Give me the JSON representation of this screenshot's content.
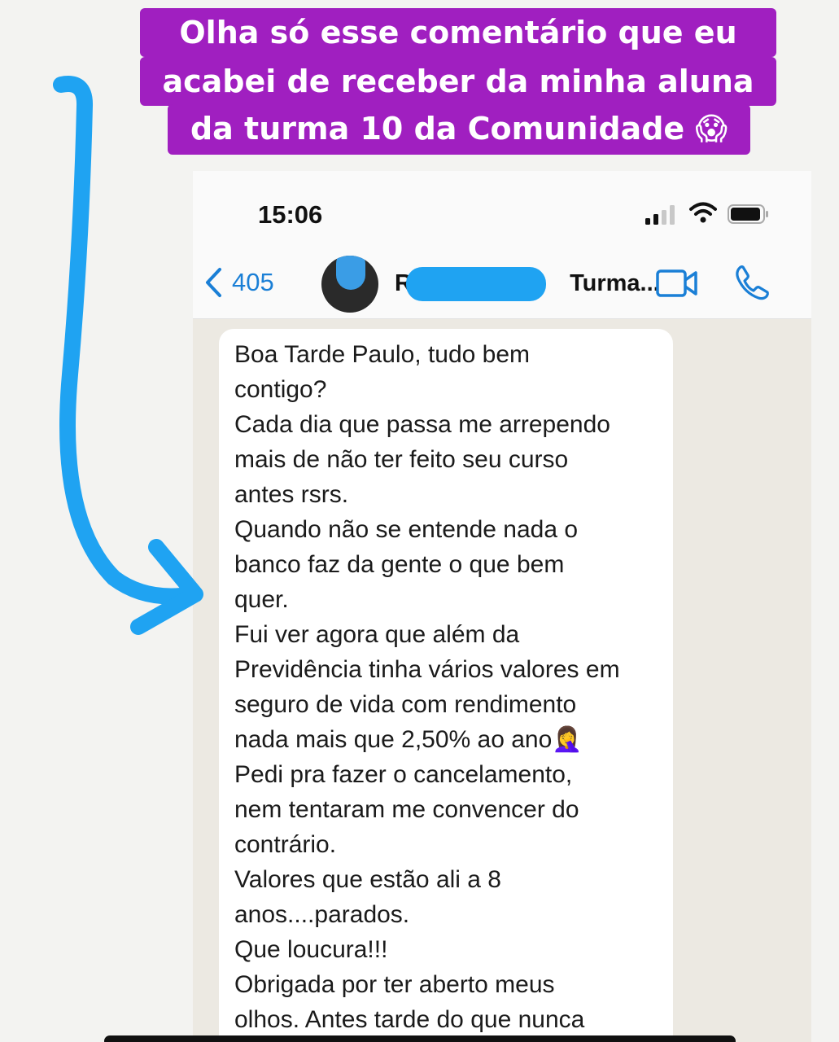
{
  "caption": {
    "line1": "Olha só esse comentário que eu",
    "line2": "acabei de receber da minha aluna",
    "line3": "da turma 10 da Comunidade 😱"
  },
  "status_bar": {
    "time": "15:06"
  },
  "chat_header": {
    "back_count": "405",
    "contact_name_start": "R",
    "contact_name_end": "Turma..."
  },
  "message": {
    "lines": [
      "Boa Tarde Paulo, tudo bem",
      "contigo?",
      "Cada dia que passa me arrependo",
      "mais de não ter feito seu curso",
      "antes rsrs.",
      "Quando não se entende nada o",
      "banco faz da gente o que bem",
      "quer.",
      "Fui ver agora que além da",
      "Previdência tinha vários valores em",
      "seguro de vida com rendimento",
      "nada mais que 2,50% ao ano🤦‍♀️",
      "Pedi pra fazer o cancelamento,",
      "nem tentaram me convencer do",
      "contrário.",
      "Valores que estão ali a 8",
      "anos....parados.",
      "Que loucura!!!",
      "Obrigada por ter aberto meus",
      "olhos. Antes tarde do que nunca"
    ]
  },
  "colors": {
    "caption_bg": "#a01fc0",
    "arrow": "#1fa3f2",
    "ios_blue": "#1a7fd6"
  },
  "icons": [
    "back-chevron-icon",
    "video-call-icon",
    "phone-call-icon",
    "signal-icon",
    "wifi-icon",
    "battery-icon"
  ]
}
